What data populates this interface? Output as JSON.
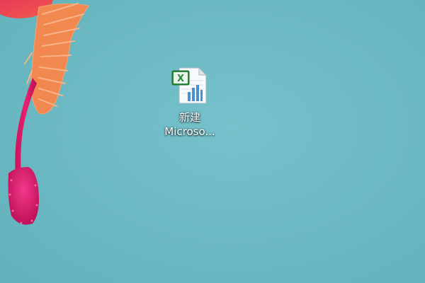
{
  "desktop": {
    "background_color": "#6dbac4",
    "wallpaper": "pink-flower-stamen"
  },
  "icons": [
    {
      "type": "excel-spreadsheet-file-icon",
      "label_line1": "新建",
      "label_line2": "Microso...",
      "accent_color": "#2e8b3e"
    }
  ]
}
